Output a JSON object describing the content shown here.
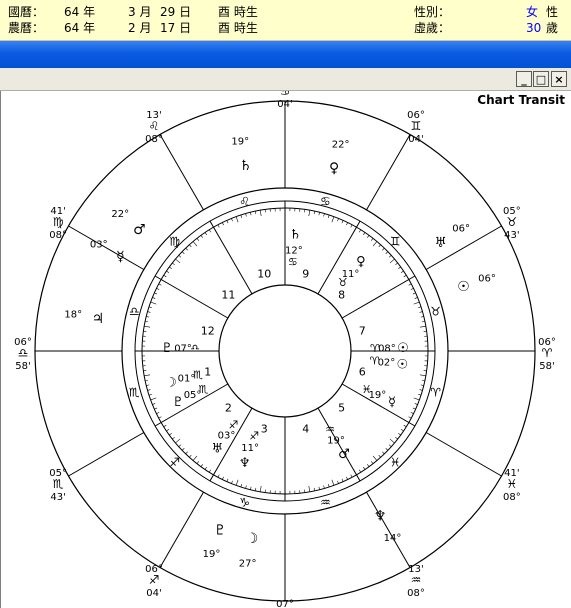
{
  "header": {
    "gregorian": {
      "label": "國曆：",
      "year": "64 年",
      "month": "3 月",
      "day": "29 日",
      "hour": "酉 時生"
    },
    "lunar": {
      "label": "農曆：",
      "year": "64 年",
      "month": "2 月",
      "day": "17 日",
      "hour": "酉 時生"
    },
    "gender": {
      "label": "性別：",
      "value": "女",
      "suffix": "性"
    },
    "age": {
      "label": "虛歲：",
      "value": "30",
      "suffix": "歲"
    }
  },
  "window": {
    "minimize_glyph": "_",
    "maximize_glyph": "□",
    "close_glyph": "×"
  },
  "chart": {
    "title": "Chart Transit",
    "house_numbers": [
      "1",
      "2",
      "3",
      "4",
      "5",
      "6",
      "7",
      "8",
      "9",
      "10",
      "11",
      "12"
    ],
    "inner_planets": [
      {
        "glyph": "♄",
        "deg": "12°",
        "sign": "♋"
      },
      {
        "glyph": "♀",
        "deg": "11°",
        "sign": "♉"
      },
      {
        "glyph": "☉",
        "deg": "08°",
        "sign": "♈"
      },
      {
        "glyph": "☉",
        "deg": "02°",
        "sign": "♈"
      },
      {
        "glyph": "☿",
        "deg": "19°",
        "sign": "♓"
      },
      {
        "glyph": "♂",
        "deg": "19°",
        "sign": "♒"
      },
      {
        "glyph": "♆",
        "deg": "11°",
        "sign": "♐"
      },
      {
        "glyph": "♅",
        "deg": "03°",
        "sign": "♐"
      },
      {
        "glyph": "♇",
        "deg": "05°",
        "sign": "♏"
      },
      {
        "glyph": "☽",
        "deg": "01°",
        "sign": "♏"
      },
      {
        "glyph": "♇",
        "deg": "07°",
        "sign": "♎"
      }
    ],
    "outer_planets": [
      {
        "glyph": "♄",
        "deg": "19°"
      },
      {
        "glyph": "♀",
        "deg": "22°"
      },
      {
        "glyph": "♅",
        "deg": "06°"
      },
      {
        "glyph": "☉",
        "deg": "06°"
      },
      {
        "glyph": "♂",
        "deg": "22°"
      },
      {
        "glyph": "☿",
        "deg": "03°"
      },
      {
        "glyph": "♃",
        "deg": "18°"
      },
      {
        "glyph": "♆",
        "deg": "14°"
      },
      {
        "glyph": "♇",
        "deg": "19°"
      },
      {
        "glyph": "☽",
        "deg": "27°"
      }
    ],
    "cusps": [
      {
        "deg": "07°",
        "sign": "♋",
        "min": "04'"
      },
      {
        "deg": "06°",
        "sign": "♊",
        "min": "04'"
      },
      {
        "deg": "05°",
        "sign": "♉",
        "min": "43'"
      },
      {
        "deg": "06°",
        "sign": "♈",
        "min": "58'"
      },
      {
        "deg": "41'",
        "sign": "♓",
        "min": "08°"
      },
      {
        "deg": "13'",
        "sign": "♒",
        "min": "08°"
      },
      {
        "deg": "07°",
        "sign": "♑",
        "min": "04'"
      },
      {
        "deg": "06°",
        "sign": "♐",
        "min": "04'"
      },
      {
        "deg": "05°",
        "sign": "♏",
        "min": "43'"
      },
      {
        "deg": "06°",
        "sign": "♎",
        "min": "58'"
      },
      {
        "deg": "41'",
        "sign": "♍",
        "min": "08°"
      },
      {
        "deg": "13'",
        "sign": "♌",
        "min": "08°"
      }
    ],
    "zodiac_ring": [
      "♋",
      "♊",
      "♉",
      "♈",
      "♓",
      "♒",
      "♑",
      "♐",
      "♏",
      "♎",
      "♍",
      "♌"
    ]
  }
}
